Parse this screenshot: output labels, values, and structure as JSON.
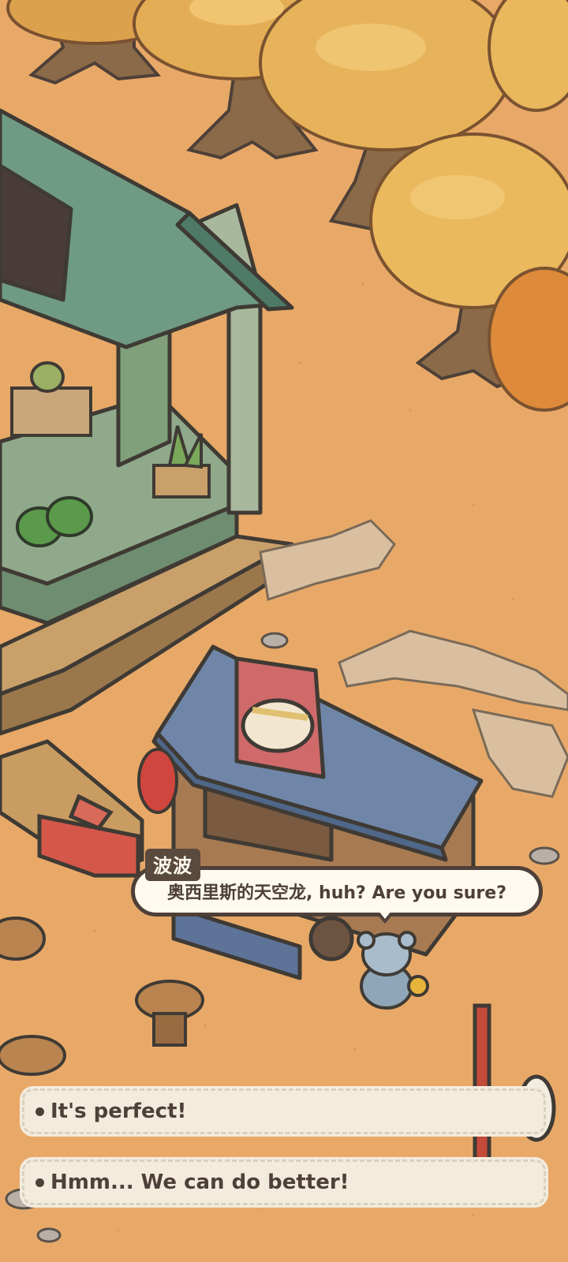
{
  "dialogue": {
    "speaker": "波波",
    "line": "奥西里斯的天空龙, huh? Are you sure?"
  },
  "choices": [
    {
      "label": "It's perfect!"
    },
    {
      "label": "Hmm... We can do better!"
    }
  ],
  "colors": {
    "ground": "#e8a968",
    "bubble_border": "#4e4038",
    "bubble_fill": "#fffaf0",
    "choice_fill": "#f3ecdd"
  }
}
